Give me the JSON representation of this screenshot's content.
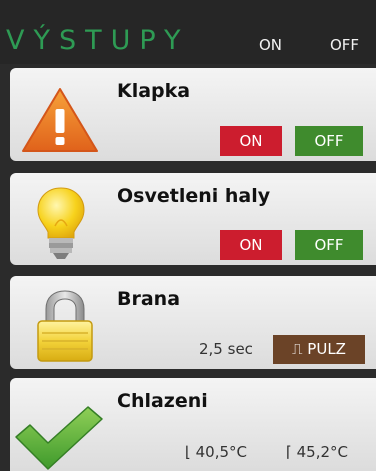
{
  "header": {
    "title": "VÝSTUPY",
    "col_on": "ON",
    "col_off": "OFF"
  },
  "outputs": [
    {
      "name": "Klapka",
      "icon": "warning-icon",
      "on_label": "ON",
      "off_label": "OFF"
    },
    {
      "name": "Osvetleni haly",
      "icon": "lightbulb-icon",
      "on_label": "ON",
      "off_label": "OFF"
    },
    {
      "name": "Brana",
      "icon": "lock-icon",
      "delay": "2,5 sec",
      "pulse_label": "⎍ PULZ"
    },
    {
      "name": "Chlazeni",
      "icon": "checkmark-icon",
      "temp_low": "⌊ 40,5°C",
      "temp_high": "⌈ 45,2°C"
    }
  ],
  "colors": {
    "title_green": "#2e9b54",
    "on_red": "#cc1d2e",
    "off_green": "#3f8b2d",
    "pulse_brown": "#6b4327"
  }
}
